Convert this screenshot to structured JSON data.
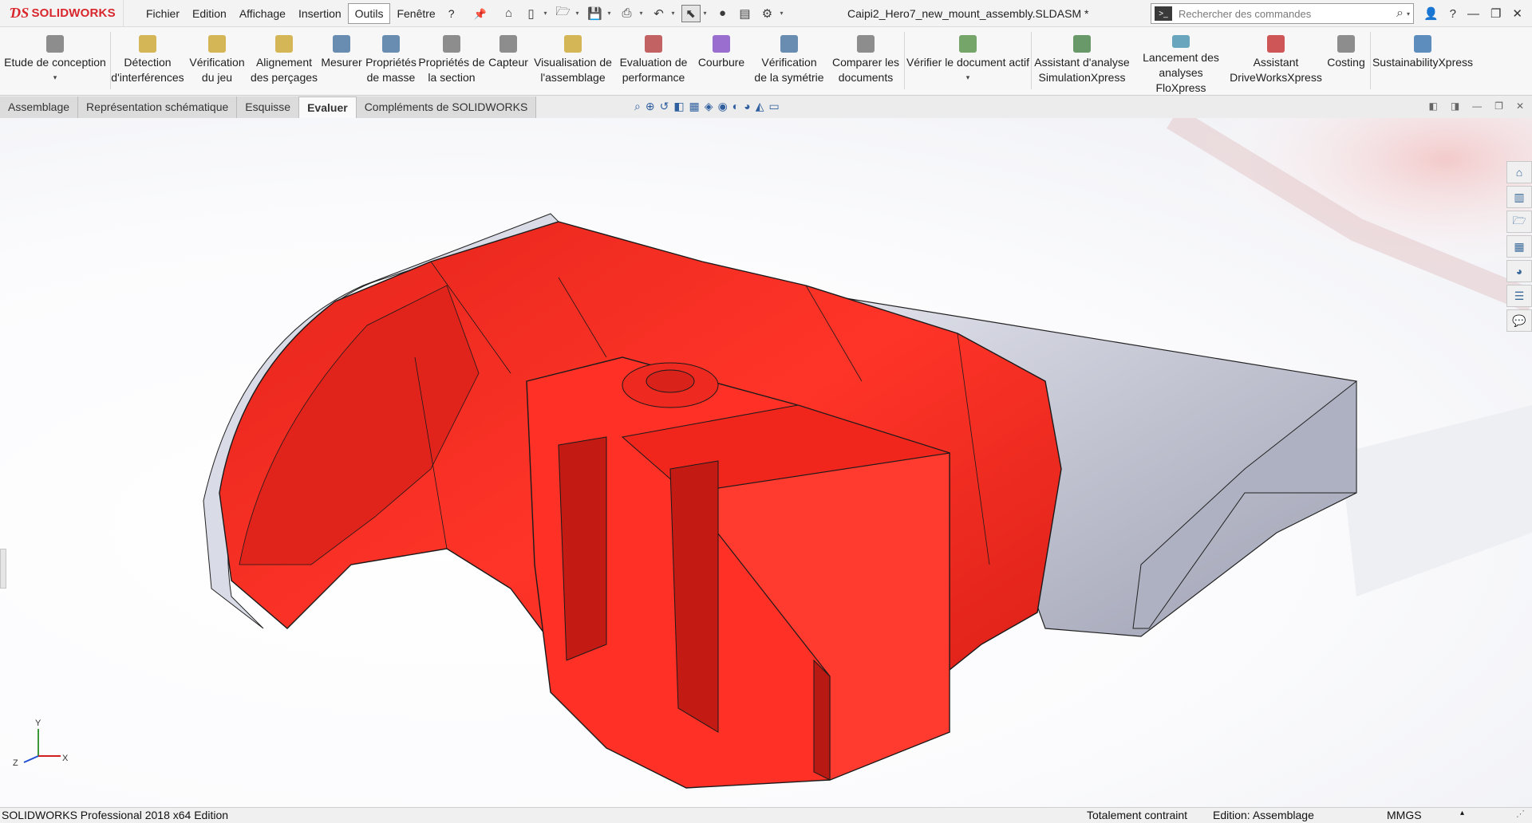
{
  "app": {
    "brand": "SOLIDWORKS",
    "document_title": "Caipi2_Hero7_new_mount_assembly.SLDASM *"
  },
  "menu": [
    {
      "label": "Fichier"
    },
    {
      "label": "Edition"
    },
    {
      "label": "Affichage"
    },
    {
      "label": "Insertion"
    },
    {
      "label": "Outils"
    },
    {
      "label": "Fenêtre"
    },
    {
      "label": "?"
    }
  ],
  "search": {
    "placeholder": "Rechercher des commandes"
  },
  "ribbon": [
    {
      "label1": "Etude de conception",
      "label2": "",
      "icon": "design-study-icon",
      "color": "#6a6a6a"
    },
    {
      "label1": "Détection",
      "label2": "d'interférences",
      "icon": "interference-icon",
      "color": "#c8a020"
    },
    {
      "label1": "Vérification",
      "label2": "du jeu",
      "icon": "clearance-icon",
      "color": "#c8a020"
    },
    {
      "label1": "Alignement",
      "label2": "des perçages",
      "icon": "hole-alignment-icon",
      "color": "#c8a020"
    },
    {
      "label1": "Mesurer",
      "label2": "",
      "icon": "measure-icon",
      "color": "#3a6a9a"
    },
    {
      "label1": "Propriétés",
      "label2": "de masse",
      "icon": "mass-properties-icon",
      "color": "#3a6a9a"
    },
    {
      "label1": "Propriétés de",
      "label2": "la section",
      "icon": "section-properties-icon",
      "color": "#6a6a6a"
    },
    {
      "label1": "Capteur",
      "label2": "",
      "icon": "sensor-icon",
      "color": "#6a6a6a"
    },
    {
      "label1": "Visualisation de",
      "label2": "l'assemblage",
      "icon": "assembly-visualization-icon",
      "color": "#c8a020"
    },
    {
      "label1": "Evaluation de",
      "label2": "performance",
      "icon": "performance-icon",
      "color": "#b03030"
    },
    {
      "label1": "Courbure",
      "label2": "",
      "icon": "curvature-icon",
      "color": "#7a40c0"
    },
    {
      "label1": "Vérification",
      "label2": "de la symétrie",
      "icon": "symmetry-icon",
      "color": "#3a6a9a"
    },
    {
      "label1": "Comparer les",
      "label2": "documents",
      "icon": "compare-icon",
      "color": "#6a6a6a"
    },
    {
      "label1": "Vérifier le document actif",
      "label2": "",
      "icon": "check-document-icon",
      "color": "#4a8a3a"
    },
    {
      "label1": "Assistant d'analyse",
      "label2": "SimulationXpress",
      "icon": "simulationxpress-icon",
      "color": "#3a7a3a"
    },
    {
      "label1": "Lancement des",
      "label2": "analyses FloXpress",
      "icon": "floxpress-icon",
      "color": "#3a8aaa"
    },
    {
      "label1": "Assistant",
      "label2": "DriveWorksXpress",
      "icon": "driveworks-icon",
      "color": "#c02020"
    },
    {
      "label1": "Costing",
      "label2": "",
      "icon": "costing-icon",
      "color": "#6a6a6a"
    },
    {
      "label1": "SustainabilityXpress",
      "label2": "",
      "icon": "sustainability-icon",
      "color": "#2a6aaa"
    }
  ],
  "tabs": [
    {
      "label": "Assemblage"
    },
    {
      "label": "Représentation schématique"
    },
    {
      "label": "Esquisse"
    },
    {
      "label": "Evaluer",
      "active": true
    },
    {
      "label": "Compléments de SOLIDWORKS"
    }
  ],
  "triad": {
    "x": "X",
    "y": "Y",
    "z": "Z"
  },
  "statusbar": {
    "edition": "SOLIDWORKS Professional 2018 x64 Edition",
    "constraint": "Totalement contraint",
    "mode": "Edition: Assemblage",
    "units": "MMGS"
  },
  "colors": {
    "part_red": "#ff2a1f",
    "part_grey": "#c4c6d2",
    "brand_red": "#d8262c"
  }
}
